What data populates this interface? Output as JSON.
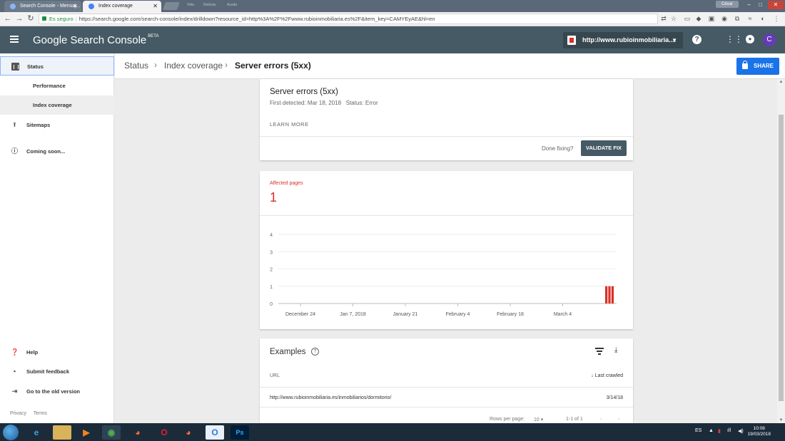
{
  "browser": {
    "tabs": [
      {
        "label": "Search Console - Mensaj..."
      },
      {
        "label": "Index coverage"
      }
    ],
    "ghost_tabs": [
      "Vida",
      "Noticias",
      "Ayuda"
    ],
    "user_chip": "César",
    "secure_label": "Es seguro",
    "url": "https://search.google.com/search-console/index/drilldown?resource_id=http%3A%2F%2Fwww.rubioinmobiliaria.es%2F&item_key=CAMYEyAE&hl=en"
  },
  "header": {
    "brand": "Google Search Console",
    "brand_sup": "BETA",
    "property": "http://www.rubioinmobiliaria....",
    "avatar_initial": "C"
  },
  "sidebar": {
    "items": [
      {
        "label": "Status",
        "icon": "bar-chart-icon"
      },
      {
        "label": "Performance"
      },
      {
        "label": "Index coverage"
      },
      {
        "label": "Sitemaps",
        "icon": "upload-icon"
      },
      {
        "label": "Coming soon...",
        "icon": "info-icon"
      }
    ],
    "bottom": [
      {
        "label": "Help",
        "icon": "help-icon"
      },
      {
        "label": "Submit feedback",
        "icon": "feedback-icon"
      },
      {
        "label": "Go to the old version",
        "icon": "exit-icon"
      }
    ],
    "footer": {
      "privacy": "Privacy",
      "terms": "Terms"
    }
  },
  "breadcrumb": {
    "items": [
      "Status",
      "Index coverage",
      "Server errors (5xx)"
    ],
    "share_label": "SHARE"
  },
  "issue": {
    "title": "Server errors (5xx)",
    "first_detected": "First detected: Mar 18, 2018",
    "status": "Status: Error",
    "learn_more": "LEARN MORE",
    "done_fixing": "Done fixing?",
    "validate_label": "VALIDATE FIX"
  },
  "affected": {
    "label": "Affected pages",
    "count": "1"
  },
  "chart_data": {
    "type": "bar",
    "yticks": [
      0,
      1,
      2,
      3,
      4
    ],
    "ylim": [
      0,
      4
    ],
    "xticks": [
      "December 24",
      "Jan 7, 2018",
      "January 21",
      "February 4",
      "February 18",
      "March 4"
    ],
    "series": [
      {
        "x": [
          "Mar 16",
          "Mar 17",
          "Mar 18"
        ],
        "values": [
          1,
          1,
          1
        ]
      }
    ],
    "bar_color": "#d93025",
    "grid": true
  },
  "examples": {
    "title": "Examples",
    "col_url": "URL",
    "col_crawled": "Last crawled",
    "rows": [
      {
        "url": "http://www.rubioinmobiliaria.es/inmobiliarios/dormitorio/",
        "date": "3/14/18"
      }
    ],
    "rows_per_page_label": "Rows per page:",
    "rows_per_page_value": "10",
    "range": "1-1 of 1"
  },
  "taskbar": {
    "lang": "ES",
    "time": "10:08",
    "date": "19/03/2018"
  }
}
